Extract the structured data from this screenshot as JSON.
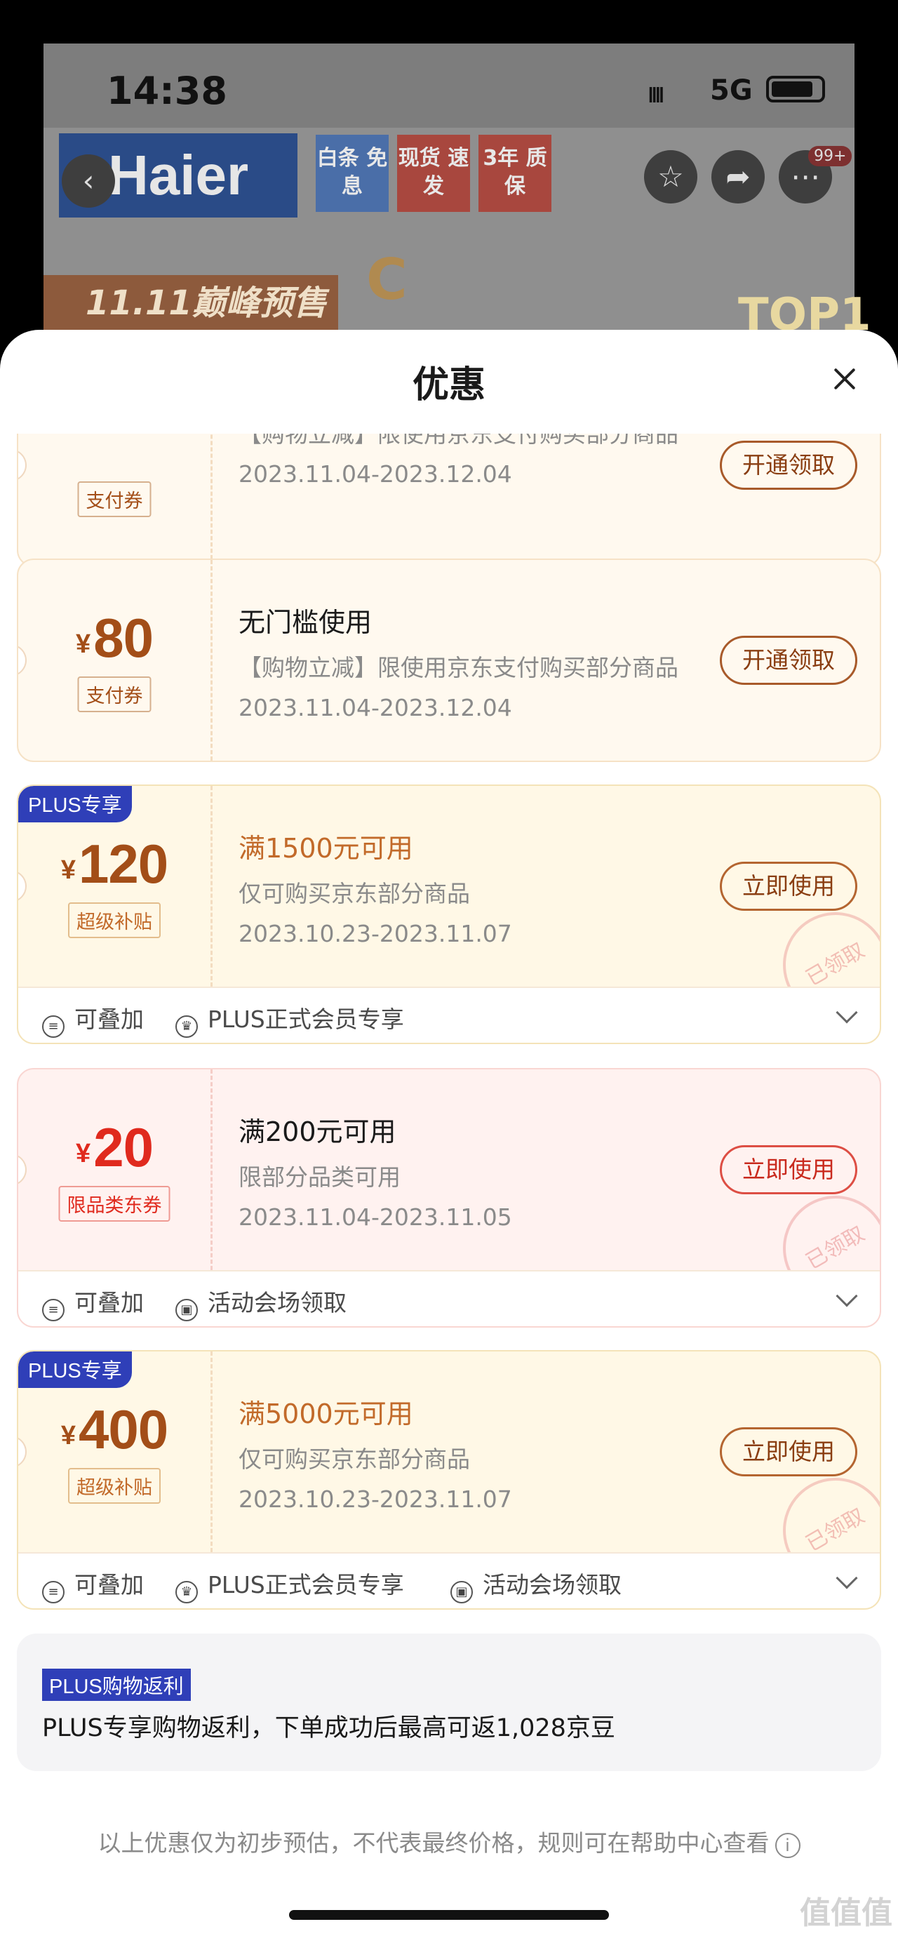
{
  "status": {
    "time": "14:38",
    "signal": "ıııı",
    "network": "5G"
  },
  "product_header": {
    "logo": "Haier",
    "tags": [
      "白条 免息",
      "现货 速发",
      "3年 质保"
    ],
    "notification_count": "99+",
    "promo": "11.11巅峰预售",
    "ranking": "TOP1"
  },
  "sheet": {
    "title": "优惠"
  },
  "coupons": [
    {
      "symbol": "¥",
      "amount": "",
      "tag": "支付券",
      "condition": "",
      "desc": "【购物立减】限使用京东支付购买部分商品",
      "date": "2023.11.04-2023.12.04",
      "action": "开通领取"
    },
    {
      "symbol": "¥",
      "amount": "80",
      "tag": "支付券",
      "condition": "无门槛使用",
      "desc": "【购物立减】限使用京东支付购买部分商品",
      "date": "2023.11.04-2023.12.04",
      "action": "开通领取"
    },
    {
      "badge": "PLUS专享",
      "symbol": "¥",
      "amount": "120",
      "tag": "超级补贴",
      "condition": "满1500元可用",
      "desc": "仅可购买京东部分商品",
      "date": "2023.10.23-2023.11.07",
      "action": "立即使用",
      "stamp": "已领取",
      "footer": [
        "可叠加",
        "PLUS正式会员专享"
      ]
    },
    {
      "symbol": "¥",
      "amount": "20",
      "tag": "限品类东券",
      "condition": "满200元可用",
      "desc": "限部分品类可用",
      "date": "2023.11.04-2023.11.05",
      "action": "立即使用",
      "stamp": "已领取",
      "footer": [
        "可叠加",
        "活动会场领取"
      ]
    },
    {
      "badge": "PLUS专享",
      "symbol": "¥",
      "amount": "400",
      "tag": "超级补贴",
      "condition": "满5000元可用",
      "desc": "仅可购买京东部分商品",
      "date": "2023.10.23-2023.11.07",
      "action": "立即使用",
      "stamp": "已领取",
      "footer": [
        "可叠加",
        "PLUS正式会员专享",
        "活动会场领取"
      ]
    }
  ],
  "rebate": {
    "tag": "PLUS购物返利",
    "text": "PLUS专享购物返利，下单成功后最高可返1,028京豆"
  },
  "footnote": "以上优惠仅为初步预估，不代表最终价格，规则可在帮助中心查看",
  "watermark": "值值值",
  "colors": {
    "brand_brown": "#a34e18",
    "red": "#e02a1e",
    "plus_blue": "#2f3fb8"
  }
}
